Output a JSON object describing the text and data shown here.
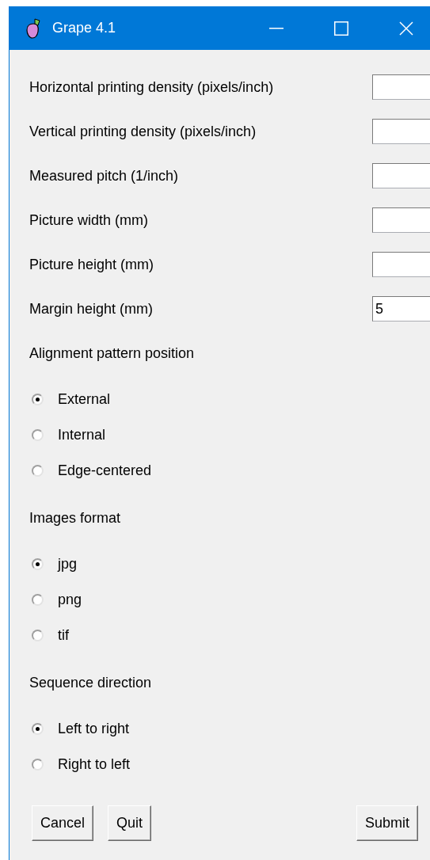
{
  "window": {
    "title": "Grape 4.1"
  },
  "fields": [
    {
      "label": "Horizontal printing density (pixels/inch)"
    },
    {
      "label": "Vertical printing density (pixels/inch)"
    },
    {
      "label": "Measured pitch (1/inch)"
    },
    {
      "label": "Picture width (mm)"
    },
    {
      "label": "Picture height (mm)"
    },
    {
      "label": "Margin height (mm)",
      "value": "5"
    }
  ],
  "groups": [
    {
      "title": "Alignment pattern position",
      "options": [
        {
          "label": "External",
          "selected": true
        },
        {
          "label": "Internal",
          "selected": false
        },
        {
          "label": "Edge-centered",
          "selected": false
        }
      ]
    },
    {
      "title": "Images format",
      "options": [
        {
          "label": "jpg",
          "selected": true
        },
        {
          "label": "png",
          "selected": false
        },
        {
          "label": "tif",
          "selected": false
        }
      ]
    },
    {
      "title": "Sequence direction",
      "options": [
        {
          "label": "Left to right",
          "selected": true
        },
        {
          "label": "Right to left",
          "selected": false
        }
      ]
    }
  ],
  "buttons_left": [
    "Cancel",
    "Quit"
  ],
  "buttons_right": [
    "Submit"
  ]
}
